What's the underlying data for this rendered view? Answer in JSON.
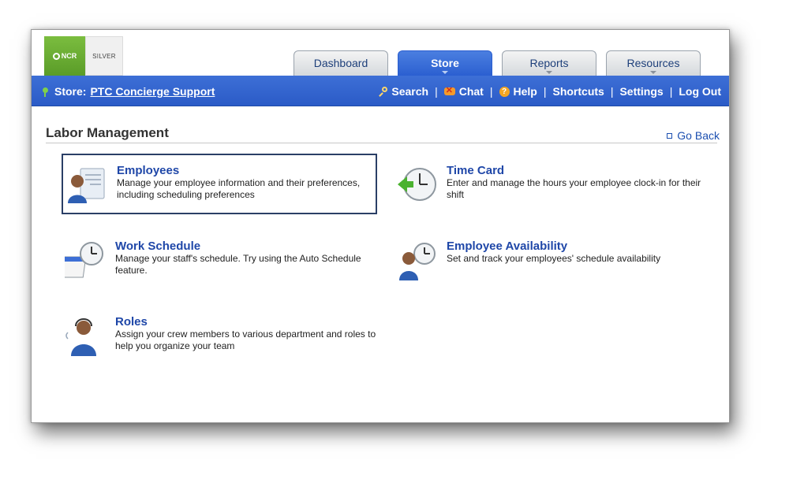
{
  "logos": {
    "ncr": "NCR",
    "silver": "SILVER"
  },
  "tabs": [
    {
      "label": "Dashboard",
      "active": false,
      "caret": false
    },
    {
      "label": "Store",
      "active": true,
      "caret": true
    },
    {
      "label": "Reports",
      "active": false,
      "caret": true
    },
    {
      "label": "Resources",
      "active": false,
      "caret": true
    }
  ],
  "navbar": {
    "store_prefix": "Store:",
    "store_name": "PTC Concierge Support",
    "links": {
      "search": "Search",
      "chat": "Chat",
      "help": "Help",
      "shortcuts": "Shortcuts",
      "settings": "Settings",
      "logout": "Log Out"
    },
    "separator": "|"
  },
  "page": {
    "title": "Labor Management",
    "go_back": "Go Back"
  },
  "cards": {
    "employees": {
      "title": "Employees",
      "desc": "Manage your employee information and their preferences, including scheduling preferences"
    },
    "time_card": {
      "title": "Time Card",
      "desc": "Enter and manage the hours your employee clock-in for their shift"
    },
    "work_schedule": {
      "title": "Work Schedule",
      "desc": "Manage your staff's schedule. Try using the Auto Schedule feature."
    },
    "availability": {
      "title": "Employee Availability",
      "desc": "Set and track your employees' schedule availability"
    },
    "roles": {
      "title": "Roles",
      "desc": "Assign your crew members to various department and roles to help you organize your team"
    }
  },
  "colors": {
    "accent": "#2b5bc7",
    "link": "#1f47a8",
    "brand_green": "#6aad33"
  }
}
